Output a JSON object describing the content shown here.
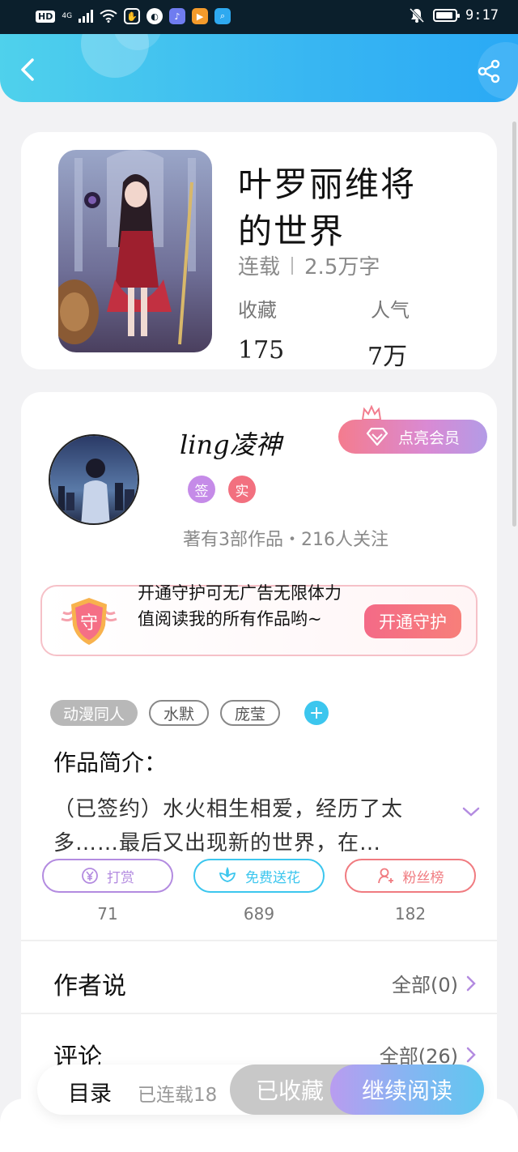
{
  "status_bar": {
    "network_badge": "HD",
    "network_type": "4G",
    "time": "9:17",
    "battery_level": 0.9
  },
  "header": {
    "back_icon": "chevron-left-icon",
    "share_icon": "share-icon",
    "gradient": [
      "#4fd1ec",
      "#2aa9f5"
    ]
  },
  "book": {
    "title": "叶罗丽维将的世界",
    "status": "连载",
    "word_count": "2.5万字",
    "favorites_label": "收藏",
    "favorites_value": "175",
    "popularity_label": "人气",
    "popularity_value": "7万"
  },
  "author": {
    "name": "ling凌神",
    "badges": [
      {
        "text": "签",
        "color": "#c58be8"
      },
      {
        "text": "实",
        "color": "#f2707f"
      }
    ],
    "stats": "著有3部作品・216人关注",
    "vip_button": "点亮会员"
  },
  "guard": {
    "shield_text": "守",
    "text": "开通守护可无广告无限体力值阅读我的所有作品哟~",
    "button": "开通守护"
  },
  "tags": {
    "items": [
      "动漫同人",
      "水默",
      "庞莹"
    ],
    "add_label": "+"
  },
  "intro": {
    "label": "作品简介：",
    "text": "（已签约）水火相生相爱，经历了太多……最后又出现新的世界，在…"
  },
  "actions": [
    {
      "label": "打赏",
      "count": "71",
      "color": "#b38be0",
      "icon": "yen-icon"
    },
    {
      "label": "免费送花",
      "count": "689",
      "color": "#3cc6ee",
      "icon": "flower-icon"
    },
    {
      "label": "粉丝榜",
      "count": "182",
      "color": "#f07b80",
      "icon": "fan-user-icon"
    }
  ],
  "rows": [
    {
      "title": "作者说",
      "link": "全部(0)"
    },
    {
      "title": "评论",
      "link": "全部(26)"
    }
  ],
  "bottom_bar": {
    "catalog": "目录",
    "serialized": "已连载18",
    "collected": "已收藏",
    "continue": "继续阅读"
  }
}
